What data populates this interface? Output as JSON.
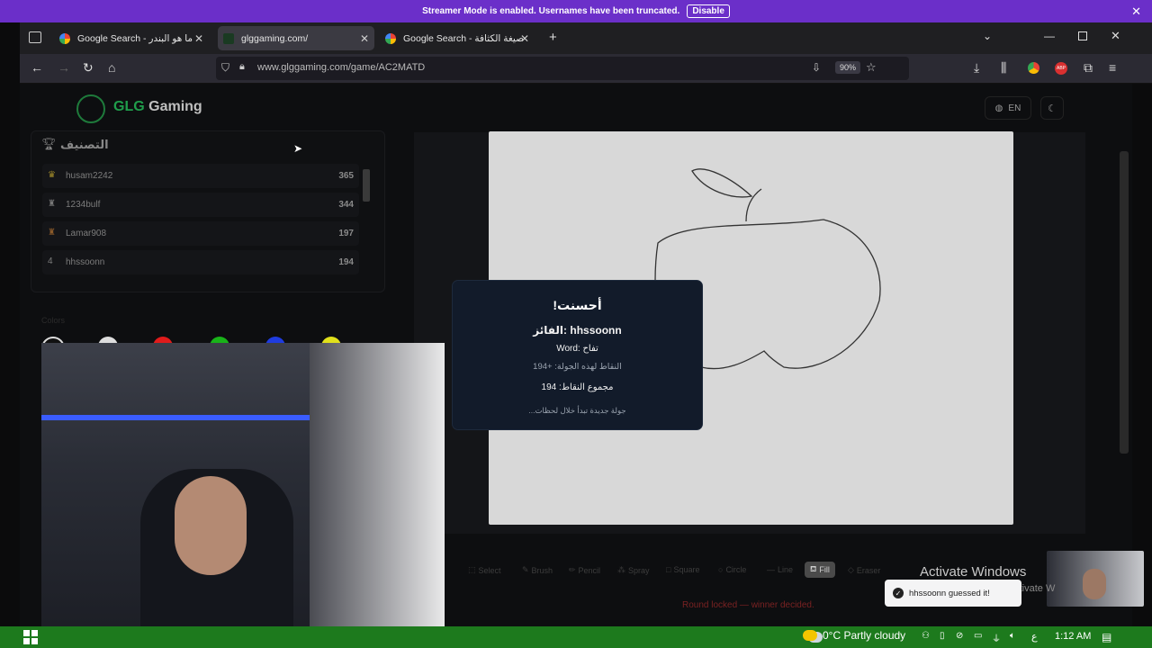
{
  "banner": {
    "text": "Streamer Mode is enabled. Usernames have been truncated.",
    "button": "Disable",
    "close": "✕"
  },
  "tabs": [
    {
      "title": "Google Search - ما هو البندر",
      "active": false
    },
    {
      "title": "glggaming.com/",
      "active": true
    },
    {
      "title": "Google Search - صيغة الكثافة",
      "active": false
    }
  ],
  "tab_close": "✕",
  "new_tab": "+",
  "address": {
    "url": "www.glggaming.com/game/AC2MATD",
    "zoom": "90%"
  },
  "site": {
    "brand_green": "GLG",
    "brand_rest": "Gaming",
    "lang": "EN"
  },
  "ranking": {
    "title": "التصنيف",
    "rows": [
      {
        "rank": "",
        "icon": "crown-icon",
        "name": "husam2242",
        "points": "365"
      },
      {
        "rank": "",
        "icon": "trophy-icon",
        "name": "1234bulf",
        "points": "344"
      },
      {
        "rank": "",
        "icon": "trophy-icon",
        "name": "Lamar908",
        "points": "197"
      },
      {
        "rank": "4",
        "icon": "",
        "name": "hhssoonn",
        "points": "194"
      }
    ]
  },
  "colors": {
    "label": "Colors",
    "swatches": [
      "#111111",
      "#dddddd",
      "#e01b1b",
      "#19b319",
      "#1f3ce0",
      "#e0e01b"
    ]
  },
  "tools": [
    "Select",
    "Brush",
    "Pencil",
    "Spray",
    "Square",
    "Circle",
    "Line",
    "Fill",
    "Eraser"
  ],
  "active_tool": "Fill",
  "round_status": "Round locked — winner decided.",
  "modal": {
    "title": "!أحسنت",
    "winner": "الفائز: hhssoonn",
    "word": "Word: تفاح",
    "round_points": "النقاط لهذه الجولة: +194",
    "total_points": "مجموع النقاط: 194",
    "next": "...جولة جديدة تبدأ خلال لحظات"
  },
  "toast": "hhssoonn guessed it!",
  "watermark": {
    "line1": "Activate Windows",
    "line2": "Go to Settings to activate W"
  },
  "taskbar": {
    "weather": "0°C  Partly cloudy",
    "time": "1:12 AM",
    "ime": "ع"
  }
}
